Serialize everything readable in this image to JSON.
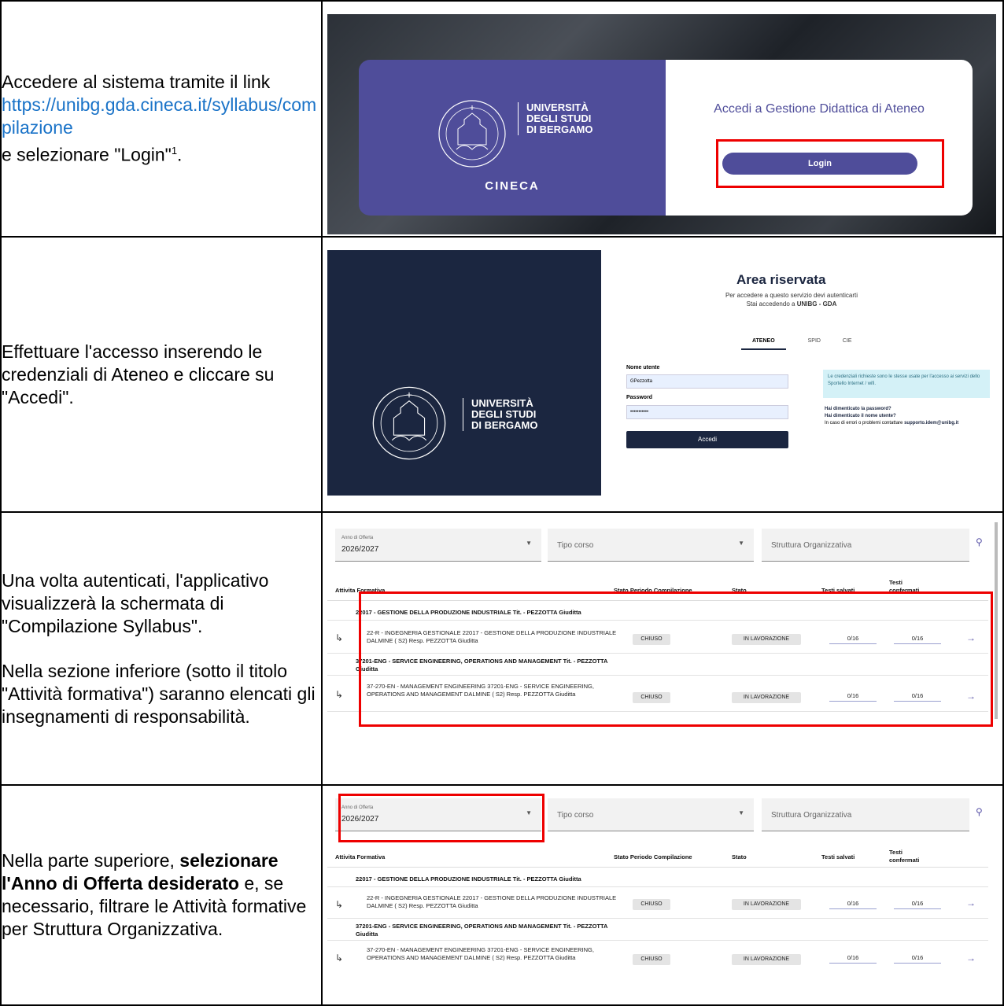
{
  "rows": [
    {
      "text_before": "Accedere al sistema tramite il link",
      "link": "https://unibg.gda.cineca.it/syllabus/compilazione",
      "text_after": "e selezionare \"Login\"",
      "footnote": "1"
    },
    {
      "text": "Effettuare l'accesso inserendo le credenziali di Ateneo e cliccare su \"Accedi\"."
    },
    {
      "p1": "Una volta autenticati, l'applicativo visualizzerà la schermata di \"Compilazione Syllabus\".",
      "p2": "Nella sezione inferiore (sotto il titolo \"Attività formativa\") saranno elencati gli insegnamenti di responsabilità."
    },
    {
      "lead": "Nella parte superiore,",
      "bold": "selezionare l'Anno di Offerta desiderato",
      "tail": "e, se necessario, filtrare le Attività formative per Struttura Organizzativa."
    }
  ],
  "login_screen": {
    "univ_line1": "UNIVERSITÀ",
    "univ_line2": "DEGLI STUDI",
    "univ_line3": "DI BERGAMO",
    "brand": "CINECA",
    "heading": "Accedi a Gestione Didattica di Ateneo",
    "login_button": "Login",
    "colors": {
      "card_left": "#4f4d9a",
      "highlight": "#ee0000"
    }
  },
  "auth_screen": {
    "title": "Area riservata",
    "subtitle1": "Per accedere a questo servizio devi autenticarti",
    "subtitle2_prefix": "Stai accedendo a",
    "subtitle2_target": "UNIBG - GDA",
    "tabs": [
      "ATENEO",
      "SPID",
      "CIE"
    ],
    "username_label": "Nome utente",
    "username_value": "GPezzotta",
    "password_label": "Password",
    "password_value": "•••••••••••",
    "accedi_button": "Accedi",
    "info": "Le credenziali richieste sono le stesse usate per l'accesso ai servizi dello Sportello Internet / wifi.",
    "forgot_password": "Hai dimenticato la password?",
    "forgot_username": "Hai dimenticato il nome utente?",
    "contact_prefix": "In caso di errori o problemi contattare",
    "contact_email": "supporto.idem@unibg.it"
  },
  "syllabus": {
    "filter_year_label": "Anno di Offerta",
    "filter_year_value": "2026/2027",
    "filter_type_placeholder": "Tipo corso",
    "filter_struct_placeholder": "Struttura Organizzativa",
    "columns": [
      "Attivita Formativa",
      "Stato Periodo Compilazione",
      "Stato",
      "Testi salvati",
      "Testi confermati"
    ],
    "groups": [
      {
        "title": "22017 - GESTIONE DELLA PRODUZIONE INDUSTRIALE   Tit. - PEZZOTTA Giuditta",
        "desc": "22-R - INGEGNERIA GESTIONALE   22017 - GESTIONE DELLA PRODUZIONE INDUSTRIALE   DALMINE  ( S2)   Resp. PEZZOTTA Giuditta",
        "period_state": "CHIUSO",
        "state": "IN LAVORAZIONE",
        "saved": "0/16",
        "confirmed": "0/16"
      },
      {
        "title": "37201-ENG - SERVICE ENGINEERING, OPERATIONS AND MANAGEMENT   Tit. - PEZZOTTA Giuditta",
        "desc": "37-270-EN - MANAGEMENT ENGINEERING   37201-ENG - SERVICE ENGINEERING, OPERATIONS AND MANAGEMENT   DALMINE  ( S2)   Resp. PEZZOTTA Giuditta",
        "period_state": "CHIUSO",
        "state": "IN LAVORAZIONE",
        "saved": "0/16",
        "confirmed": "0/16"
      }
    ]
  }
}
